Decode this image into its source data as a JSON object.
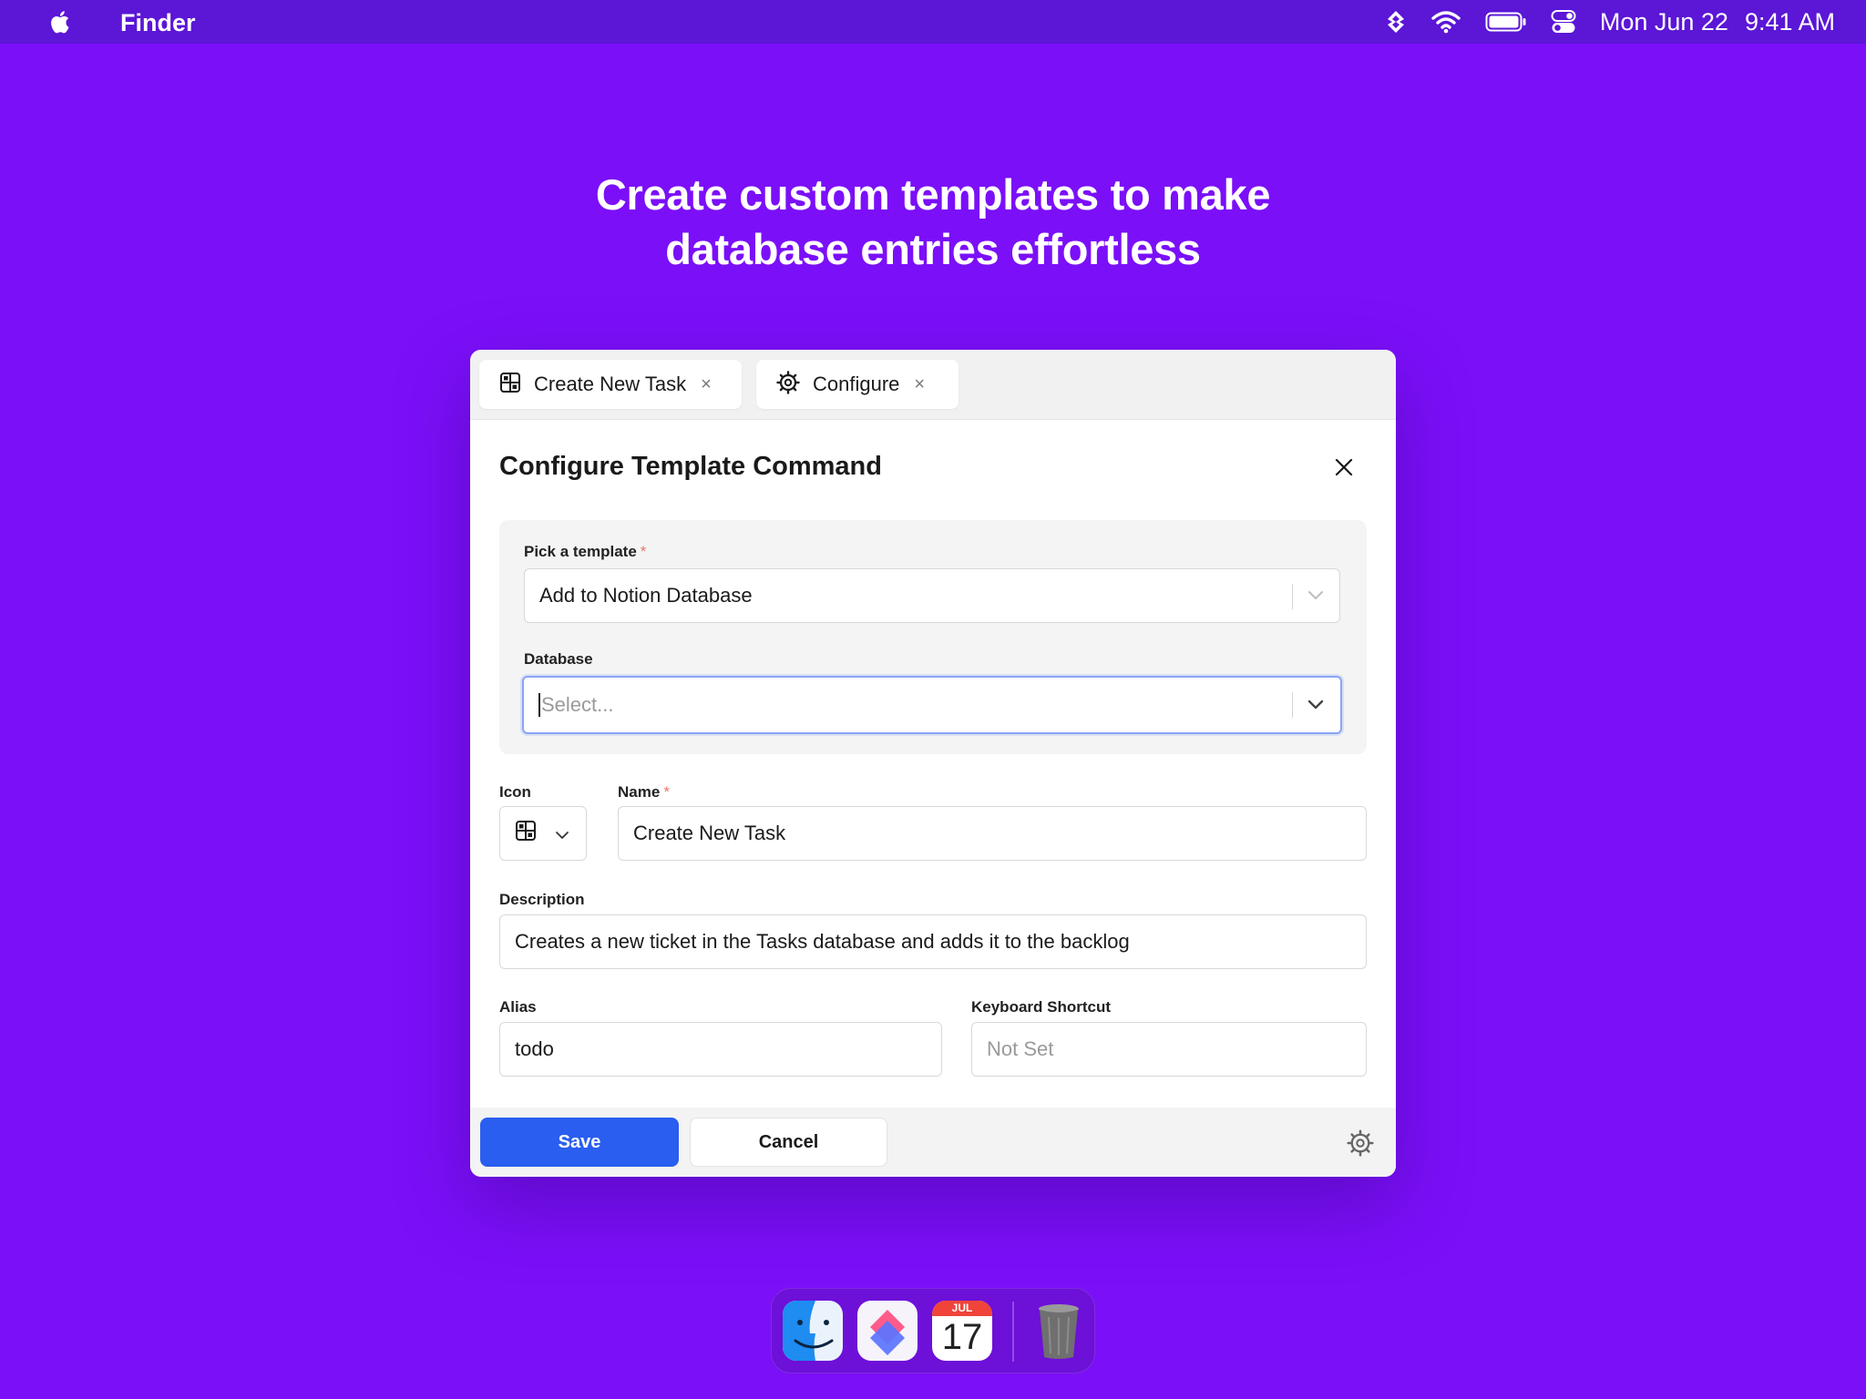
{
  "menubar": {
    "app_name": "Finder",
    "date": "Mon Jun 22",
    "time": "9:41 AM",
    "icons": [
      "apple-icon",
      "raycast-icon",
      "wifi-icon",
      "battery-icon",
      "control-center-icon"
    ]
  },
  "headline": {
    "line1": "Create custom templates to make",
    "line2": "database entries effortless"
  },
  "tabs": [
    {
      "label": "Create New Task",
      "icon": "grid-icon",
      "close": "×"
    },
    {
      "label": "Configure",
      "icon": "gear-icon",
      "close": "×"
    }
  ],
  "dialog": {
    "title": "Configure Template Command",
    "template": {
      "label": "Pick a template",
      "required": "*",
      "value": "Add to Notion Database"
    },
    "database": {
      "label": "Database",
      "placeholder": "Select..."
    },
    "icon_field": {
      "label": "Icon"
    },
    "name": {
      "label": "Name",
      "required": "*",
      "value": "Create New Task"
    },
    "description": {
      "label": "Description",
      "value": "Creates a new ticket in the Tasks database and adds it to the backlog"
    },
    "alias": {
      "label": "Alias",
      "value": "todo"
    },
    "shortcut": {
      "label": "Keyboard Shortcut",
      "placeholder": "Not Set"
    }
  },
  "footer": {
    "save": "Save",
    "cancel": "Cancel"
  },
  "dock": {
    "apps": [
      "finder-icon",
      "shortcuts-icon",
      "calendar-icon",
      "trash-icon"
    ],
    "calendar_month": "JUL",
    "calendar_day": "17"
  },
  "colors": {
    "background": "#7b0ff8",
    "menubar": "#5b16d6",
    "primary_button": "#2a5ef0",
    "focus_ring": "#8aa4f5",
    "required": "#e8776d"
  }
}
